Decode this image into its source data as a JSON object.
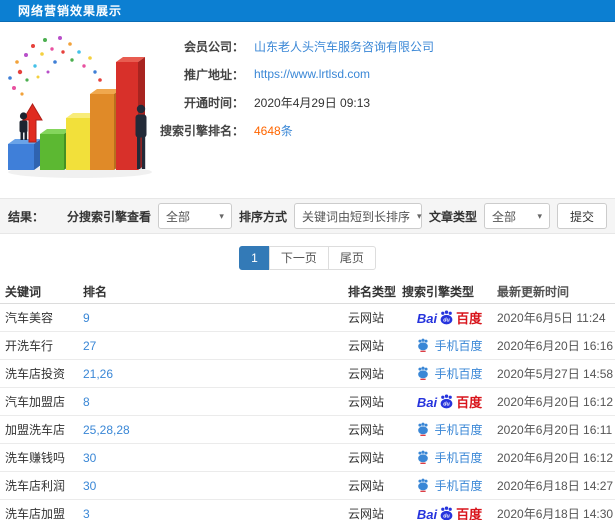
{
  "header": {
    "title": "网络营销效果展示"
  },
  "info": {
    "member_label": "会员公司：",
    "member_value": "山东老人头汽车服务咨询有限公司",
    "promo_label": "推广地址：",
    "promo_value": "https://www.lrtlsd.com",
    "open_label": "开通时间：",
    "open_value": "2020年4月29日 09:13",
    "rank_label": "搜索引擎排名：",
    "rank_count": "4648",
    "rank_unit": "条"
  },
  "filter": {
    "results_label": "结果：",
    "engine_filter_label": "分搜索引擎查看",
    "engine_filter_value": "全部",
    "sort_label": "排序方式",
    "sort_value": "关键词由短到长排序",
    "article_label": "文章类型",
    "article_value": "全部",
    "submit_label": "提交",
    "caret": "▾"
  },
  "pagination": {
    "current": "1",
    "next": "下一页",
    "last": "尾页"
  },
  "logos": {
    "baidu_bai": "Bai",
    "baidu_cn": "百度",
    "mobile_baidu": "手机百度"
  },
  "colors": {
    "topbar": "#0c7fd2",
    "link": "#3a87d6",
    "rank_count": "#ff6600",
    "active_page": "#337ab7",
    "baidu_blue": "#2634dd",
    "baidu_red": "#d8151c"
  },
  "table": {
    "headers": {
      "keyword": "关键词",
      "rank": "排名",
      "rank_type": "排名类型",
      "engine_type": "搜索引擎类型",
      "updated": "最新更新时间"
    },
    "rows": [
      {
        "keyword": "汽车美容",
        "rank": "9",
        "rank_type": "云网站",
        "engine": "百度",
        "updated": "2020年6月5日 11:24"
      },
      {
        "keyword": "开洗车行",
        "rank": "27",
        "rank_type": "云网站",
        "engine": "手机百度",
        "updated": "2020年6月20日 16:16"
      },
      {
        "keyword": "洗车店投资",
        "rank": "21,26",
        "rank_type": "云网站",
        "engine": "手机百度",
        "updated": "2020年5月27日 14:58"
      },
      {
        "keyword": "汽车加盟店",
        "rank": "8",
        "rank_type": "云网站",
        "engine": "百度",
        "updated": "2020年6月20日 16:12"
      },
      {
        "keyword": "加盟洗车店",
        "rank": "25,28,28",
        "rank_type": "云网站",
        "engine": "手机百度",
        "updated": "2020年6月20日 16:11"
      },
      {
        "keyword": "洗车赚钱吗",
        "rank": "30",
        "rank_type": "云网站",
        "engine": "手机百度",
        "updated": "2020年6月20日 16:12"
      },
      {
        "keyword": "洗车店利润",
        "rank": "30",
        "rank_type": "云网站",
        "engine": "手机百度",
        "updated": "2020年6月18日 14:27"
      },
      {
        "keyword": "洗车店加盟",
        "rank": "3",
        "rank_type": "云网站",
        "engine": "百度",
        "updated": "2020年6月18日 14:30"
      }
    ]
  }
}
